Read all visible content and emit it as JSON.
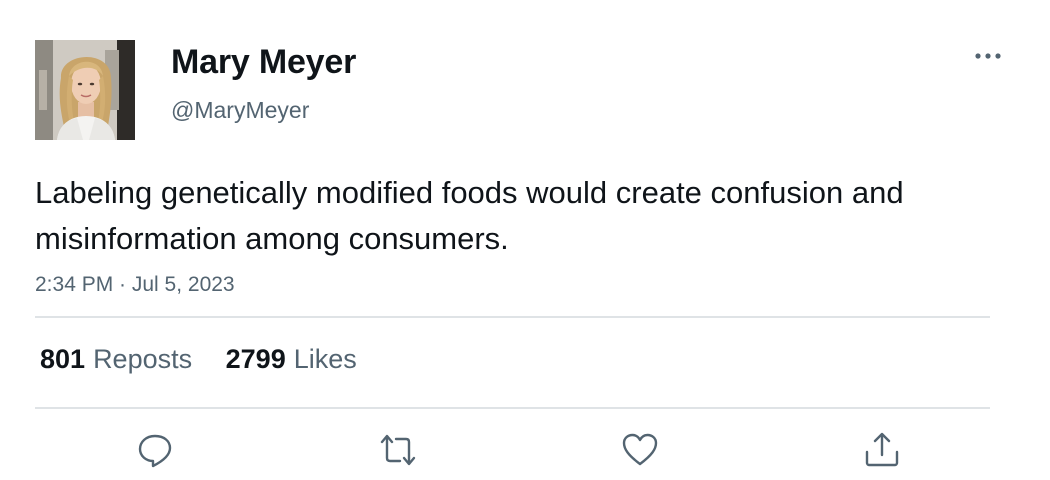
{
  "author": {
    "display_name": "Mary Meyer",
    "handle": "@MaryMeyer"
  },
  "tweet": {
    "text": "Labeling genetically modified foods would create confusion and misinformation among consumers.",
    "timestamp": "2:34 PM · Jul 5, 2023"
  },
  "stats": {
    "reposts_count": "801",
    "reposts_label": "Reposts",
    "likes_count": "2799",
    "likes_label": "Likes"
  },
  "icons": {
    "more": "more-horizontal-icon",
    "reply": "reply-icon",
    "repost": "repost-icon",
    "like": "heart-icon",
    "share": "share-icon"
  },
  "colors": {
    "text_primary": "#0f1419",
    "text_secondary": "#536471",
    "divider": "#dfe3e6"
  }
}
